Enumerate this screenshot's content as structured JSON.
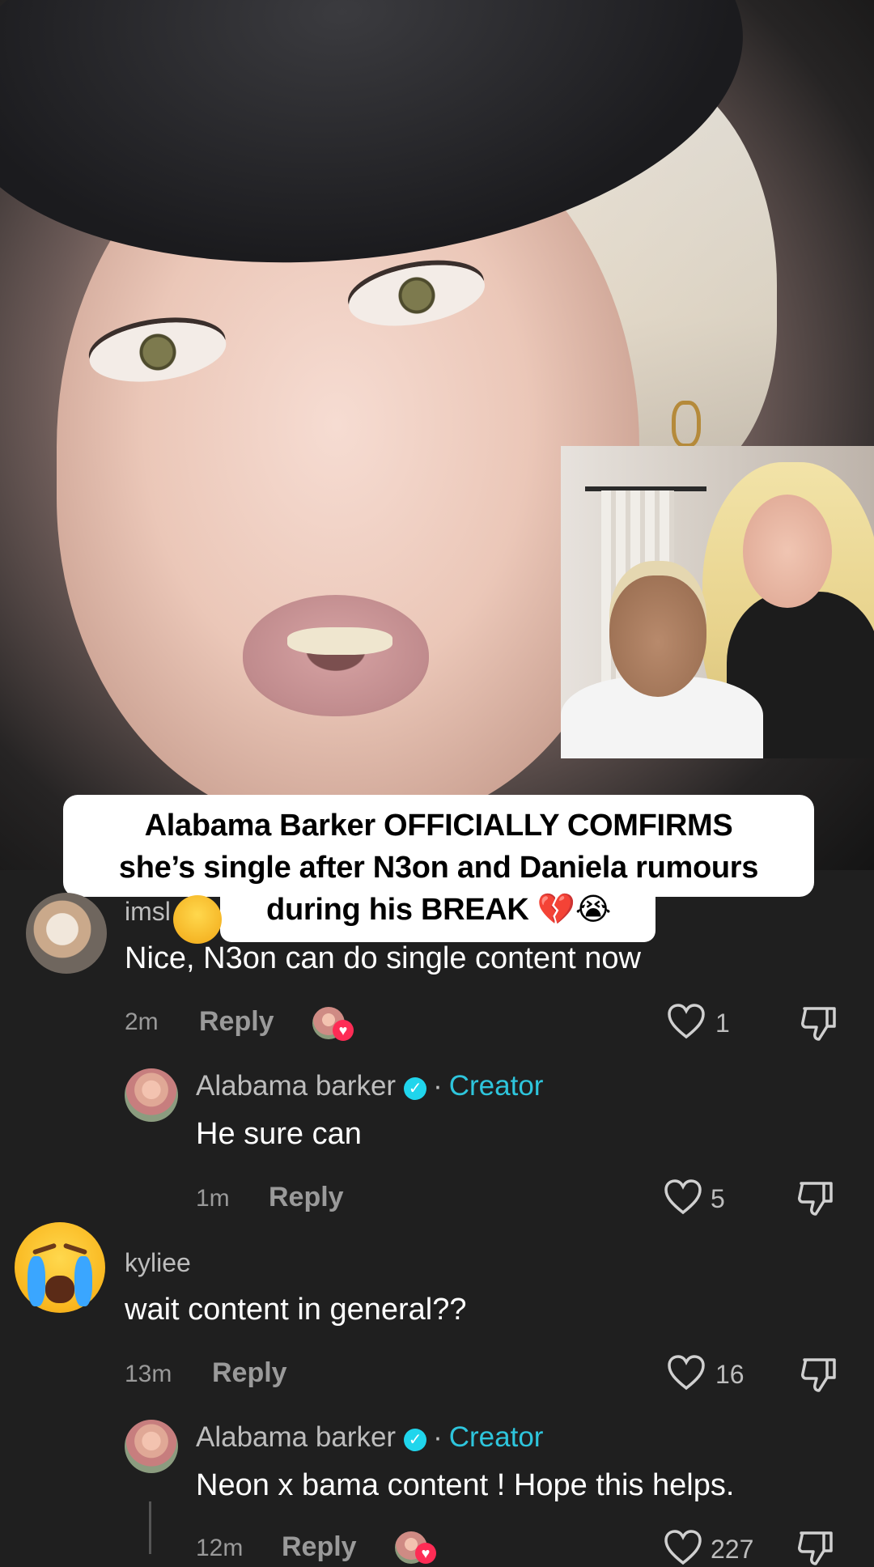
{
  "caption": {
    "lines": [
      "Alabama Barker OFFICIALLY COMFIRMS",
      "she’s single after N3on and Daniela rumours",
      "during his BREAK 💔😭"
    ]
  },
  "comments": [
    {
      "username": "imsl",
      "text": "Nice, N3on can do single content now",
      "time": "2m",
      "reply_label": "Reply",
      "likes": "1",
      "avatar_icon": "cat-avatar",
      "liked_by_creator": true,
      "replies": [
        {
          "username": "Alabama barker",
          "verified": true,
          "separator": "·",
          "tag": "Creator",
          "text": "He sure can",
          "time": "1m",
          "reply_label": "Reply",
          "likes": "5"
        }
      ]
    },
    {
      "username": "kyliee",
      "text": "wait content in general??",
      "time": "13m",
      "reply_label": "Reply",
      "likes": "16",
      "avatar_icon": "loudly-crying-emoji",
      "replies": [
        {
          "username": "Alabama barker",
          "verified": true,
          "separator": "·",
          "tag": "Creator",
          "text": "Neon x bama content ! Hope this helps.",
          "time": "12m",
          "reply_label": "Reply",
          "likes": "227",
          "liked_by_creator": true
        }
      ]
    }
  ],
  "colors": {
    "background": "#1f1f1f",
    "creator_tag": "#2ec5dc",
    "verified_badge": "#20d5ec",
    "like_heart": "#fe2c55"
  }
}
